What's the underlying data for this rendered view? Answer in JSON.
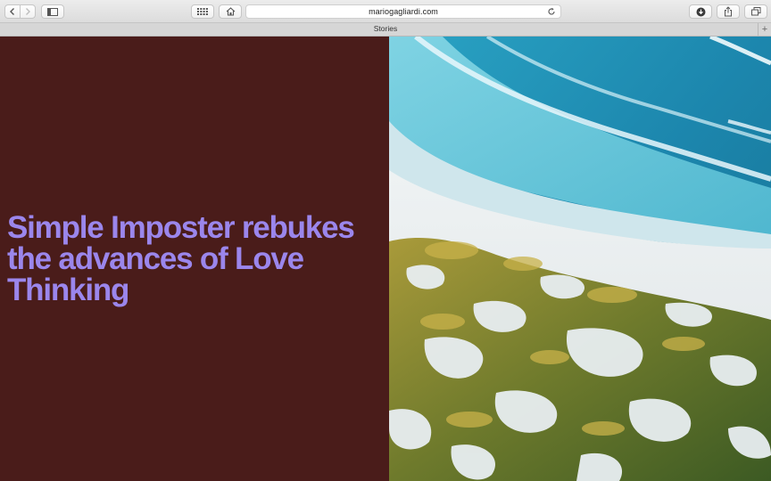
{
  "browser": {
    "url": "mariogagliardi.com",
    "tab_title": "Stories",
    "new_tab_label": "+"
  },
  "toolbar_icons": {
    "back": "chevron-left-icon",
    "forward": "chevron-right-icon",
    "sidebar": "sidebar-icon",
    "top_sites": "grid-icon",
    "home": "home-icon",
    "reload": "reload-icon",
    "downloads": "download-icon",
    "share": "share-icon",
    "tabs": "tabs-overview-icon"
  },
  "page": {
    "headline": "Simple Imposter rebukes the advances of Love Thinking"
  },
  "colors": {
    "left_panel_bg": "#4a1c1a",
    "headline": "#9b86ec"
  }
}
